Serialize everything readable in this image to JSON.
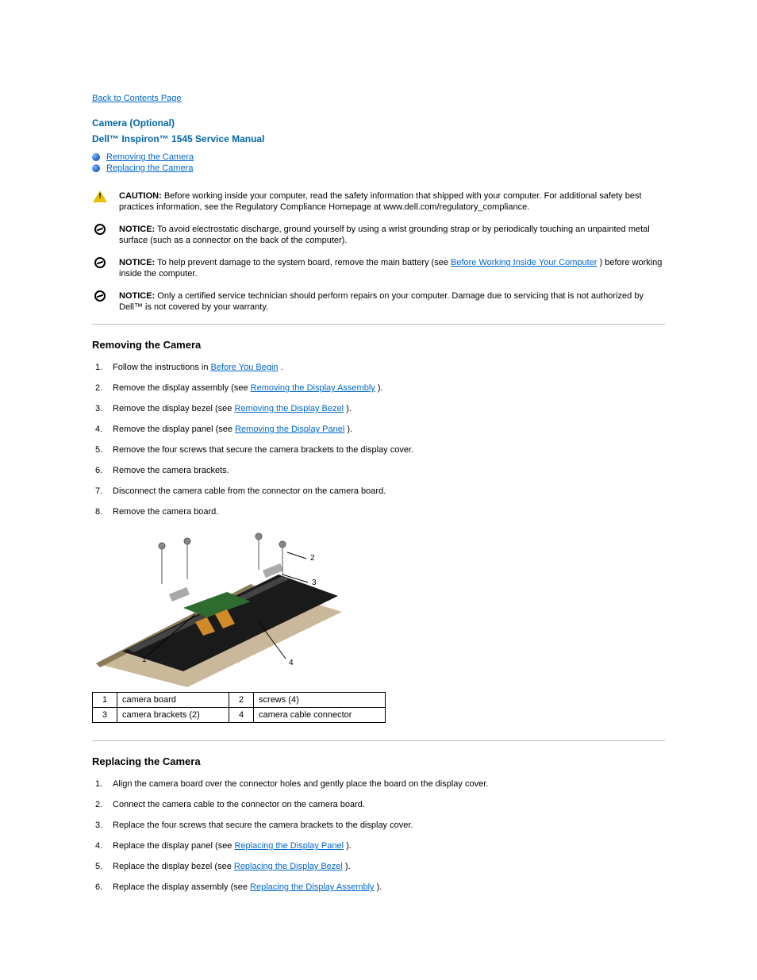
{
  "back_link": "Back to Contents Page",
  "page_title": "Camera (Optional)",
  "manual_name": "Dell™ Inspiron™ 1545 Service Manual",
  "toc": [
    "Removing the Camera",
    "Replacing the Camera"
  ],
  "notices": [
    {
      "kind": "caution",
      "lead": "CAUTION:",
      "body": "Before working inside your computer, read the safety information that shipped with your computer. For additional safety best practices information, see the Regulatory Compliance Homepage at www.dell.com/regulatory_compliance."
    },
    {
      "kind": "notice",
      "lead": "NOTICE:",
      "body": "To avoid electrostatic discharge, ground yourself by using a wrist grounding strap or by periodically touching an unpainted metal surface (such as a connector on the back of the computer)."
    },
    {
      "kind": "notice",
      "lead": "NOTICE:",
      "body_prefix": "To help prevent damage to the system board, remove the main battery (see ",
      "body_link": "Before Working Inside Your Computer",
      "body_suffix": ") before working inside the computer."
    },
    {
      "kind": "notice",
      "lead": "NOTICE:",
      "body": "Only a certified service technician should perform repairs on your computer. Damage due to servicing that is not authorized by Dell™ is not covered by your warranty."
    }
  ],
  "section_remove": {
    "heading": "Removing the Camera",
    "steps": [
      {
        "text_prefix": "Follow the instructions in ",
        "link": "Before You Begin",
        "text_suffix": "."
      },
      {
        "text_prefix": "Remove the display assembly (see ",
        "link": "Removing the Display Assembly",
        "text_suffix": ")."
      },
      {
        "text_prefix": "Remove the display bezel (see ",
        "link": "Removing the Display Bezel",
        "text_suffix": ")."
      },
      {
        "text_prefix": "Remove the display panel (see ",
        "link": "Removing the Display Panel",
        "text_suffix": ")."
      },
      {
        "text": "Remove the four screws that secure the camera brackets to the display cover."
      },
      {
        "text": "Remove the camera brackets."
      },
      {
        "text": "Disconnect the camera cable from the connector on the camera board."
      },
      {
        "text": "Remove the camera board."
      }
    ]
  },
  "legend": {
    "r1c1": "1",
    "r1c2": "camera board",
    "r1c3": "2",
    "r1c4": "screws (4)",
    "r2c1": "3",
    "r2c2": "camera brackets (2)",
    "r2c3": "4",
    "r2c4": "camera cable connector"
  },
  "section_replace": {
    "heading": "Replacing the Camera",
    "steps": [
      {
        "text": "Align the camera board over the connector holes and gently place the board on the display cover."
      },
      {
        "text": "Connect the camera cable to the connector on the camera board."
      },
      {
        "text": "Replace the four screws that secure the camera brackets to the display cover."
      },
      {
        "text_prefix": "Replace the display panel (see ",
        "link": "Replacing the Display Panel",
        "text_suffix": ")."
      },
      {
        "text_prefix": "Replace the display bezel (see ",
        "link": "Replacing the Display Bezel",
        "text_suffix": ")."
      },
      {
        "text_prefix": "Replace the display assembly (see ",
        "link": "Replacing the Display Assembly",
        "text_suffix": ")."
      }
    ]
  },
  "callouts": [
    "1",
    "2",
    "3",
    "4"
  ]
}
